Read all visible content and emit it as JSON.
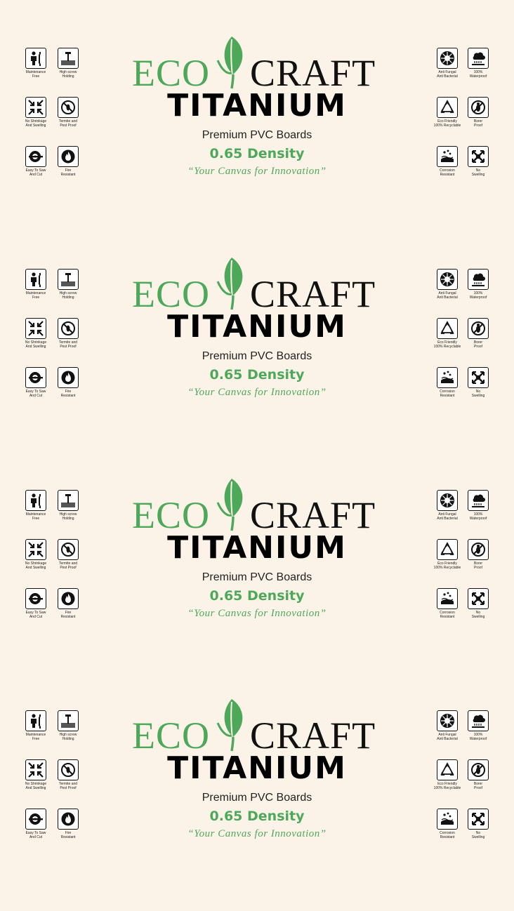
{
  "logo": {
    "eco": "ECO",
    "craft": "CRAFT",
    "leaf_icon": "leaf-icon",
    "eco_color": "#4ea85a",
    "craft_color": "#111111"
  },
  "brand": "TITANIUM",
  "subtitle": "Premium PVC Boards",
  "density": "0.65 Density",
  "tagline": "“Your Canvas for Innovation”",
  "accent_color": "#4ea85a",
  "background_color": "#fbf3e8",
  "badges": {
    "maintenance": {
      "label": "Maintenance\nFree",
      "icon": "worker-wrench-icon"
    },
    "screw": {
      "label": "High screw\nHolding",
      "icon": "screw-icon"
    },
    "shrinkage": {
      "label": "No Shrinkage\nAnd Swelling",
      "icon": "shrink-arrows-icon"
    },
    "termite": {
      "label": "Termite and\nPest Proof",
      "icon": "no-termite-icon"
    },
    "saw": {
      "label": "Easy To Saw\nAnd Cut",
      "icon": "saw-blade-icon"
    },
    "fire": {
      "label": "Fire\nResistant",
      "icon": "fire-resistant-icon"
    },
    "antifungal": {
      "label": "Anti Fungal\nAnti Bacterial",
      "icon": "anti-bacterial-icon"
    },
    "waterproof": {
      "label": "100%\nWaterproof",
      "icon": "waterproof-icon"
    },
    "recyclable": {
      "label": "Eco Friendly\n100% Recyclable",
      "icon": "recycle-icon"
    },
    "borer": {
      "label": "Borer\nProof",
      "icon": "no-borer-icon"
    },
    "corrosion": {
      "label": "Corrosion\nResistant",
      "icon": "corrosion-icon"
    },
    "swelling": {
      "label": "No\nSwelling",
      "icon": "no-swelling-icon"
    }
  }
}
